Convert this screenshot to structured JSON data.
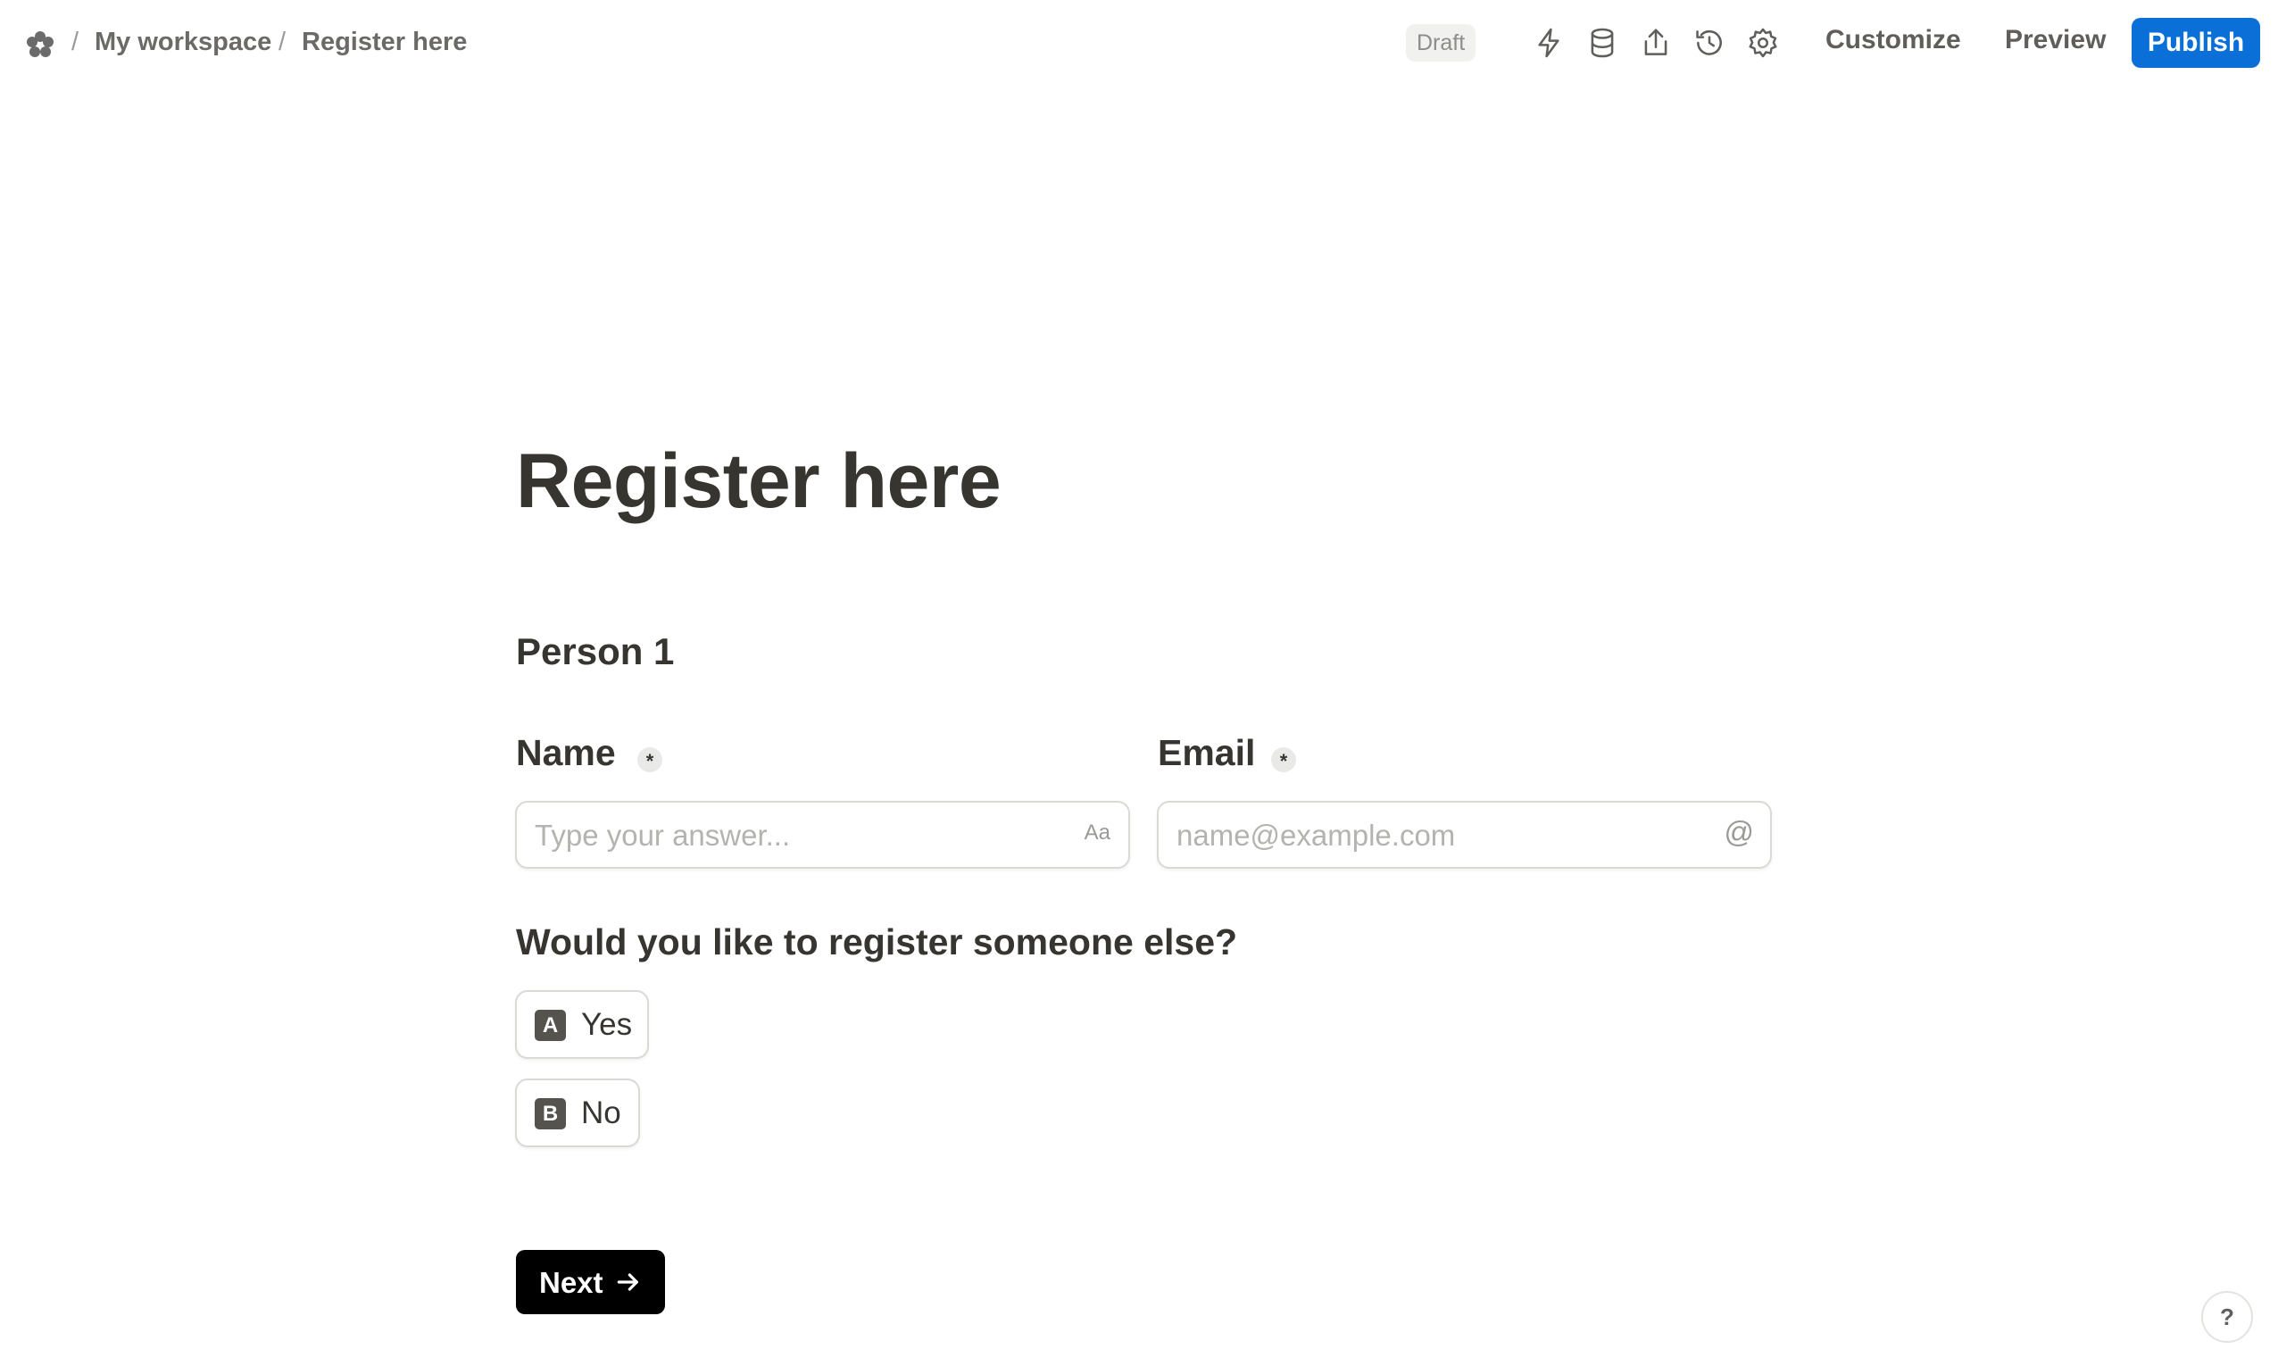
{
  "breadcrumb": {
    "workspace": "My workspace",
    "page": "Register here",
    "separator": "/"
  },
  "toolbar": {
    "status_badge": "Draft",
    "icons": [
      "lightning-icon",
      "database-icon",
      "share-icon",
      "history-icon",
      "settings-icon"
    ],
    "customize_label": "Customize",
    "preview_label": "Preview",
    "publish_label": "Publish"
  },
  "form": {
    "title": "Register here",
    "section_title": "Person 1",
    "fields": {
      "name": {
        "label": "Name",
        "required_mark": "*",
        "placeholder": "Type your answer...",
        "suffix": "Aa"
      },
      "email": {
        "label": "Email",
        "required_mark": "*",
        "placeholder": "name@example.com",
        "suffix": "@"
      }
    },
    "question": "Would you like to register someone else?",
    "choices": [
      {
        "key": "A",
        "label": "Yes"
      },
      {
        "key": "B",
        "label": "No"
      }
    ],
    "next_label": "Next"
  },
  "help": {
    "label": "?"
  },
  "colors": {
    "accent": "#0a6fd6",
    "text": "#37352f",
    "muted": "#6b6a67",
    "button_dark": "#000000"
  }
}
